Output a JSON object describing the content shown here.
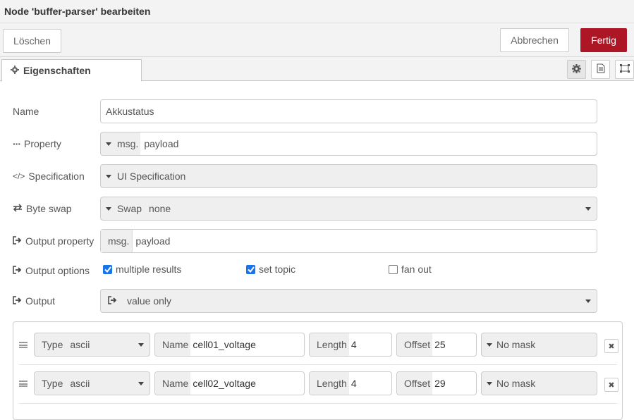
{
  "title": "Node 'buffer-parser' bearbeiten",
  "toolbar": {
    "delete_label": "Löschen",
    "cancel_label": "Abbrechen",
    "done_label": "Fertig"
  },
  "tabs": {
    "properties_label": "Eigenschaften"
  },
  "form": {
    "name_label": "Name",
    "name_value": "Akkustatus",
    "property_label": "Property",
    "property_prefix": "msg.",
    "property_value": "payload",
    "spec_label": "Specification",
    "spec_value": "UI Specification",
    "byteswap_label": "Byte swap",
    "byteswap_prefix": "Swap",
    "byteswap_value": "none",
    "outprop_label": "Output property",
    "outprop_prefix": "msg.",
    "outprop_value": "payload",
    "outopts_label": "Output options",
    "opt_multiple": "multiple results",
    "opt_multiple_checked": true,
    "opt_settopic": "set topic",
    "opt_settopic_checked": true,
    "opt_fanout": "fan out",
    "opt_fanout_checked": false,
    "output_label": "Output",
    "output_value": "value only"
  },
  "rows": [
    {
      "type_label": "Type",
      "type_value": "ascii",
      "name_label": "Name",
      "name_value": "cell01_voltage",
      "length_label": "Length",
      "length_value": "4",
      "offset_label": "Offset",
      "offset_value": "25",
      "mask_value": "No mask"
    },
    {
      "type_label": "Type",
      "type_value": "ascii",
      "name_label": "Name",
      "name_value": "cell02_voltage",
      "length_label": "Length",
      "length_value": "4",
      "offset_label": "Offset",
      "offset_value": "29",
      "mask_value": "No mask"
    }
  ],
  "colors": {
    "primary": "#ad1625",
    "checkbox": "#1a73e8"
  }
}
